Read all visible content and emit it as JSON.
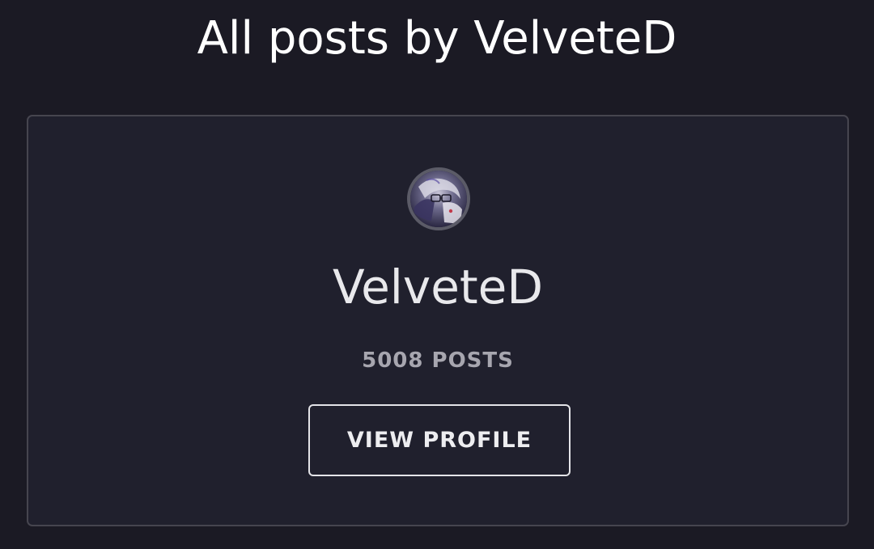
{
  "page": {
    "title": "All posts by VelveteD"
  },
  "profile_card": {
    "username": "VelveteD",
    "post_count": "5008 POSTS",
    "view_profile_label": "VIEW PROFILE"
  },
  "colors": {
    "background": "#1b1a24",
    "card_background": "#20202d",
    "card_border": "#46454f",
    "title_text": "#ffffff",
    "muted_text": "#a7a6af"
  }
}
